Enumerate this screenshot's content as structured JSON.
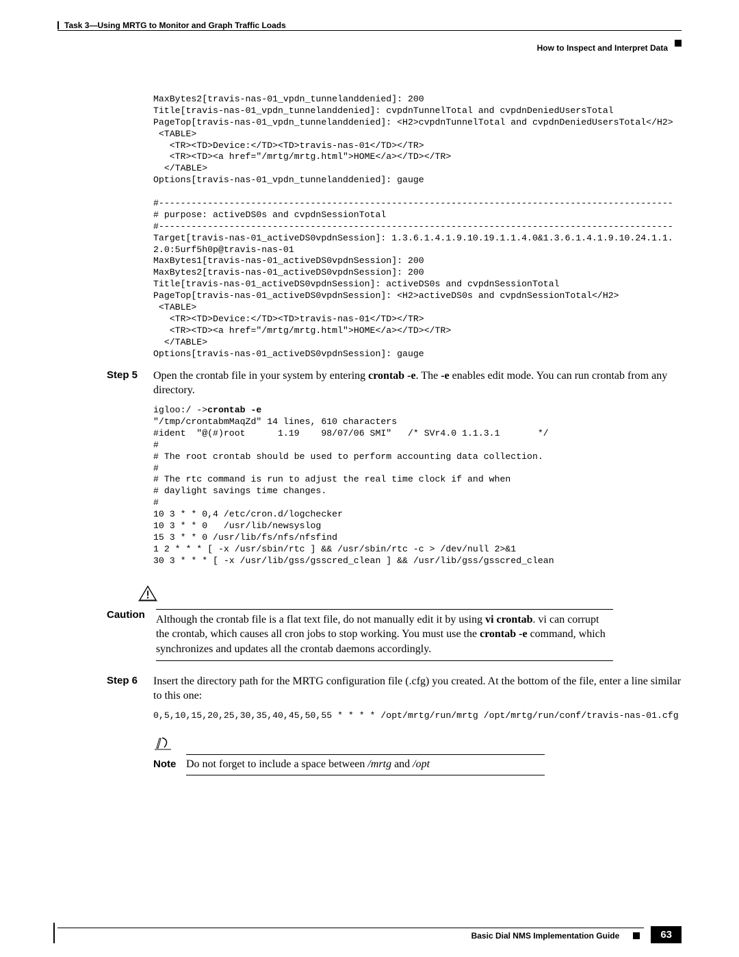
{
  "header": {
    "task_line": "Task 3—Using MRTG to Monitor and Graph Traffic Loads",
    "section_line": "How to Inspect and Interpret Data"
  },
  "code_block1": "MaxBytes2[travis-nas-01_vpdn_tunnelanddenied]: 200\nTitle[travis-nas-01_vpdn_tunnelanddenied]: cvpdnTunnelTotal and cvpdnDeniedUsersTotal\nPageTop[travis-nas-01_vpdn_tunnelanddenied]: <H2>cvpdnTunnelTotal and cvpdnDeniedUsersTotal</H2>\n <TABLE>\n   <TR><TD>Device:</TD><TD>travis-nas-01</TD></TR>\n   <TR><TD><a href=\"/mrtg/mrtg.html\">HOME</a></TD></TR>\n  </TABLE>\nOptions[travis-nas-01_vpdn_tunnelanddenied]: gauge\n\n#-----------------------------------------------------------------------------------------------\n# purpose: activeDS0s and cvpdnSessionTotal\n#-----------------------------------------------------------------------------------------------\nTarget[travis-nas-01_activeDS0vpdnSession]: 1.3.6.1.4.1.9.10.19.1.1.4.0&1.3.6.1.4.1.9.10.24.1.1.2.0:5urf5h0p@travis-nas-01\nMaxBytes1[travis-nas-01_activeDS0vpdnSession]: 200\nMaxBytes2[travis-nas-01_activeDS0vpdnSession]: 200\nTitle[travis-nas-01_activeDS0vpdnSession]: activeDS0s and cvpdnSessionTotal\nPageTop[travis-nas-01_activeDS0vpdnSession]: <H2>activeDS0s and cvpdnSessionTotal</H2>\n <TABLE>\n   <TR><TD>Device:</TD><TD>travis-nas-01</TD></TR>\n   <TR><TD><a href=\"/mrtg/mrtg.html\">HOME</a></TD></TR>\n  </TABLE>\nOptions[travis-nas-01_activeDS0vpdnSession]: gauge",
  "step5": {
    "label": "Step 5",
    "text_p1": "Open the crontab file in your system by entering ",
    "cmd1": "crontab -e",
    "text_p2": ". The ",
    "cmd2": "-e",
    "text_p3": " enables edit mode. You can run crontab from any directory."
  },
  "code_block2_prompt": "igloo:/ ->",
  "code_block2_cmd": "crontab -e",
  "code_block2_rest": "\"/tmp/crontabmMaqZd\" 14 lines, 610 characters\n#ident  \"@(#)root      1.19    98/07/06 SMI\"   /* SVr4.0 1.1.3.1       */\n#\n# The root crontab should be used to perform accounting data collection.\n#\n# The rtc command is run to adjust the real time clock if and when\n# daylight savings time changes.\n#\n10 3 * * 0,4 /etc/cron.d/logchecker\n10 3 * * 0   /usr/lib/newsyslog\n15 3 * * 0 /usr/lib/fs/nfs/nfsfind\n1 2 * * * [ -x /usr/sbin/rtc ] && /usr/sbin/rtc -c > /dev/null 2>&1\n30 3 * * * [ -x /usr/lib/gss/gsscred_clean ] && /usr/lib/gss/gsscred_clean",
  "caution": {
    "label": "Caution",
    "t1": "Although the crontab file is a flat text file, do not manually edit it by using ",
    "b1": "vi crontab",
    "t2": ". vi can corrupt the crontab, which causes all cron jobs to stop working. You must use the ",
    "b2": "crontab -e",
    "t3": " command, which synchronizes and updates all the crontab daemons accordingly."
  },
  "step6": {
    "label": "Step 6",
    "text": "Insert the directory path for the MRTG configuration file (.cfg) you created. At the bottom of the file, enter a line similar to this one:"
  },
  "code_block3": "0,5,10,15,20,25,30,35,40,45,50,55 * * * * /opt/mrtg/run/mrtg /opt/mrtg/run/conf/travis-nas-01.cfg",
  "note": {
    "label": "Note",
    "t1": "Do not forget to include a space between ",
    "i1": "/mrtg",
    "t2": " and ",
    "i2": "/opt"
  },
  "footer": {
    "title": "Basic Dial NMS Implementation Guide",
    "page": "63"
  }
}
